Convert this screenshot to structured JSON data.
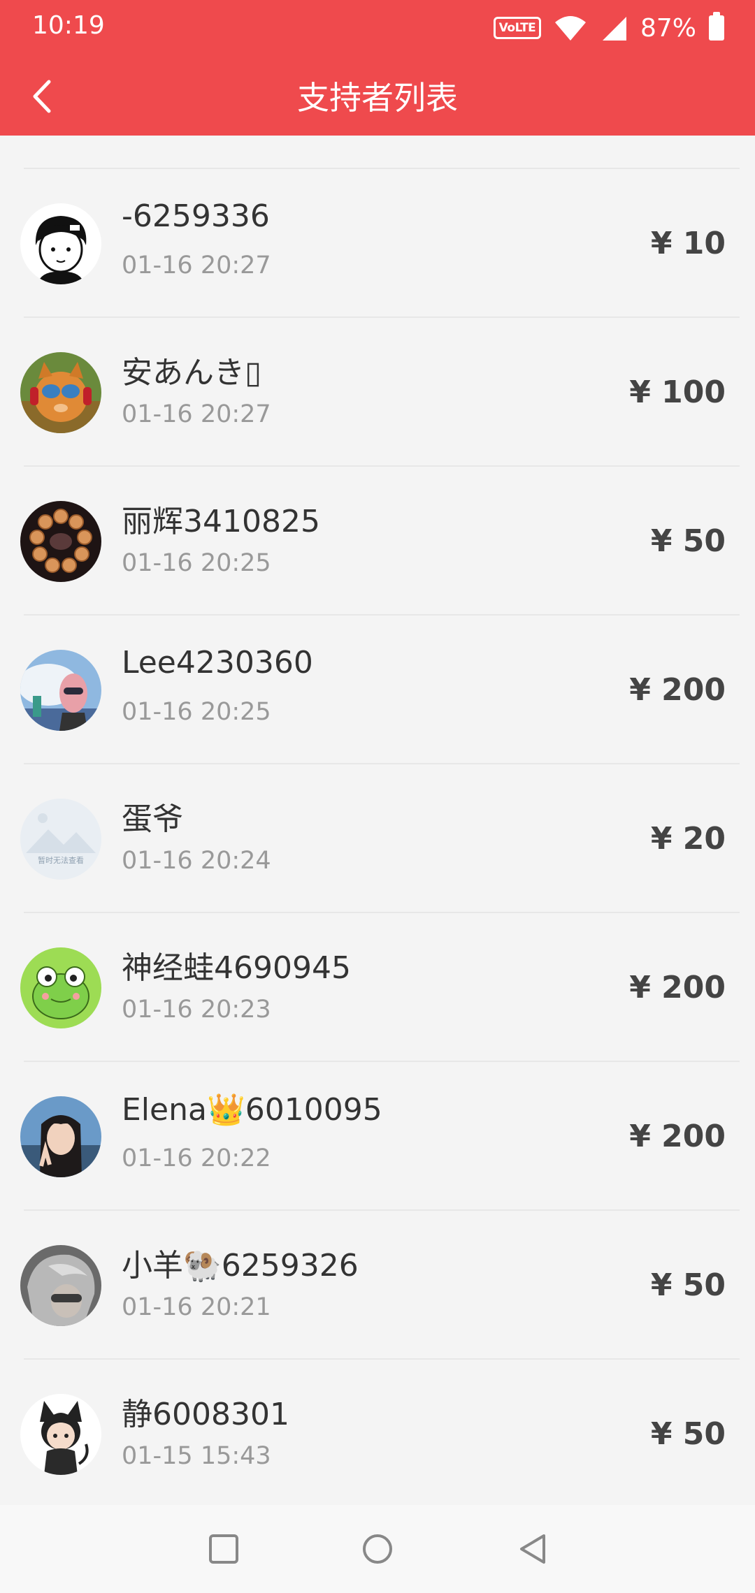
{
  "status_bar": {
    "time": "10:19",
    "volte_label": "VoLTE",
    "battery_percent": "87%"
  },
  "header": {
    "title": "支持者列表",
    "back_icon": "chevron-left-icon"
  },
  "supporters": [
    {
      "name": "-6259336",
      "time": "01-16 20:27",
      "amount": "¥ 10"
    },
    {
      "name": "安あんき▯",
      "time": "01-16 20:27",
      "amount": "¥ 100"
    },
    {
      "name": "丽辉3410825",
      "time": "01-16 20:25",
      "amount": "¥ 50"
    },
    {
      "name": "Lee4230360",
      "time": "01-16 20:25",
      "amount": "¥ 200"
    },
    {
      "name": "蛋爷",
      "time": "01-16 20:24",
      "amount": "¥ 20",
      "avatar_placeholder_text": "暂时无法查看"
    },
    {
      "name": "神经蛙4690945",
      "time": "01-16 20:23",
      "amount": "¥ 200"
    },
    {
      "name": "Elena👑6010095",
      "time": "01-16 20:22",
      "amount": "¥ 200"
    },
    {
      "name": "小羊🐏6259326",
      "time": "01-16 20:21",
      "amount": "¥ 50"
    },
    {
      "name": "静6008301",
      "time": "01-15 15:43",
      "amount": "¥ 50"
    }
  ],
  "system_nav": {
    "recents_icon": "square-icon",
    "home_icon": "circle-icon",
    "back_icon": "triangle-back-icon"
  },
  "colors": {
    "header_bg": "#ef4a4d",
    "list_bg": "#f4f4f4",
    "name_text": "#333333",
    "time_text": "#999999",
    "amount_text": "#444444"
  }
}
